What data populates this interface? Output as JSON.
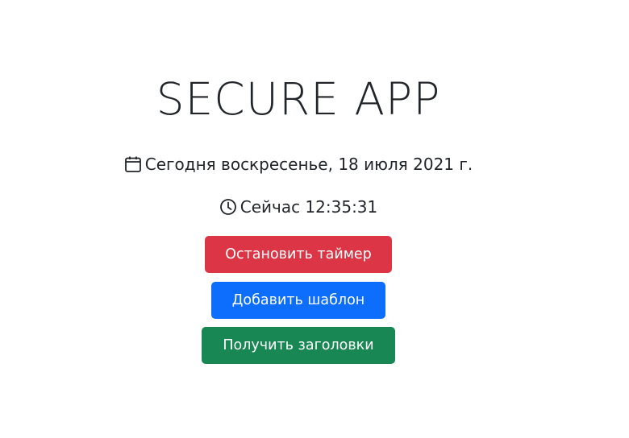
{
  "app": {
    "title": "SECURE APP"
  },
  "date_line": {
    "icon": "calendar-icon",
    "text": "Сегодня воскресенье, 18 июля 2021 г."
  },
  "time_line": {
    "icon": "clock-icon",
    "text": "Сейчас 12:35:31"
  },
  "buttons": {
    "stop_timer": {
      "label": "Остановить таймер",
      "color": "#dc3545"
    },
    "add_template": {
      "label": "Добавить шаблон",
      "color": "#0d6efd"
    },
    "get_headers": {
      "label": "Получить заголовки",
      "color": "#198754"
    }
  }
}
